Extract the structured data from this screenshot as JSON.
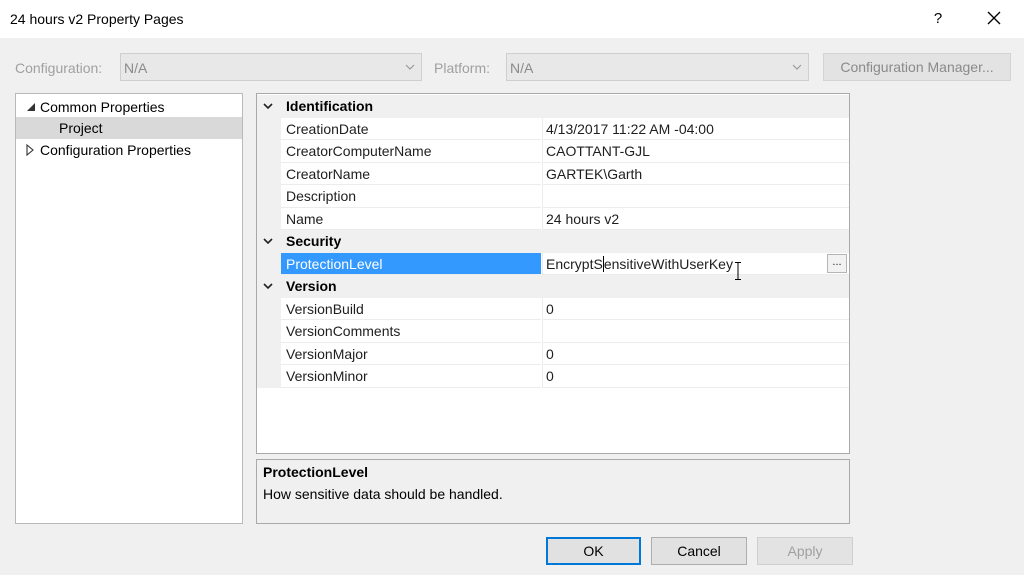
{
  "window": {
    "title": "24 hours v2 Property Pages",
    "help_label": "?"
  },
  "toolbar": {
    "configuration_label": "Configuration:",
    "configuration_value": "N/A",
    "platform_label": "Platform:",
    "platform_value": "N/A",
    "configuration_manager_label": "Configuration Manager..."
  },
  "tree": {
    "items": [
      {
        "label": "Common Properties",
        "expanded": true
      },
      {
        "label": "Project",
        "selected": true
      },
      {
        "label": "Configuration Properties",
        "expanded": false
      }
    ]
  },
  "grid": {
    "categories": [
      {
        "label": "Identification",
        "properties": [
          {
            "name": "CreationDate",
            "value": "4/13/2017 11:22 AM -04:00"
          },
          {
            "name": "CreatorComputerName",
            "value": "CAOTTANT-GJL"
          },
          {
            "name": "CreatorName",
            "value": "GARTEK\\Garth"
          },
          {
            "name": "Description",
            "value": ""
          },
          {
            "name": "Name",
            "value": "24 hours v2"
          }
        ]
      },
      {
        "label": "Security",
        "properties": [
          {
            "name": "ProtectionLevel",
            "value_before_caret": "EncryptS",
            "value_after_caret": "ensitiveWithUserKey",
            "selected": true,
            "ellipsis": "..."
          }
        ]
      },
      {
        "label": "Version",
        "properties": [
          {
            "name": "VersionBuild",
            "value": "0"
          },
          {
            "name": "VersionComments",
            "value": ""
          },
          {
            "name": "VersionMajor",
            "value": "0"
          },
          {
            "name": "VersionMinor",
            "value": "0"
          }
        ]
      }
    ]
  },
  "description": {
    "title": "ProtectionLevel",
    "text": "How sensitive data should be handled."
  },
  "buttons": {
    "ok": "OK",
    "cancel": "Cancel",
    "apply": "Apply"
  },
  "colors": {
    "selection": "#3399ff",
    "focus_border": "#0078d7"
  }
}
